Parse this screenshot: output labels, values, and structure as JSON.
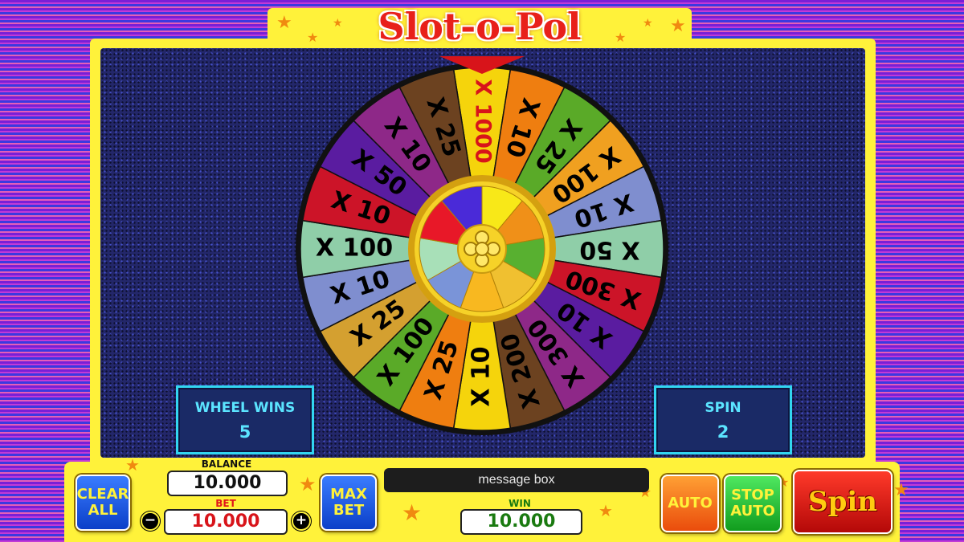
{
  "game": {
    "title": "Slot-o-Pol"
  },
  "wheel": {
    "segments": [
      {
        "label": "X 1000",
        "color": "#f5d40c",
        "text_color": "#d8141a"
      },
      {
        "label": "X 10",
        "color": "#ef7e10"
      },
      {
        "label": "X 25",
        "color": "#5aaa28"
      },
      {
        "label": "X 100",
        "color": "#f0a020"
      },
      {
        "label": "X 10",
        "color": "#7f8ecf"
      },
      {
        "label": "X 50",
        "color": "#8fcea8"
      },
      {
        "label": "X 300",
        "color": "#cc1428"
      },
      {
        "label": "X 10",
        "color": "#5a1ca0"
      },
      {
        "label": "X 300",
        "color": "#8e2888"
      },
      {
        "label": "X 200",
        "color": "#6c4220"
      },
      {
        "label": "X 10",
        "color": "#f5d40c"
      },
      {
        "label": "X 25",
        "color": "#ef7e10"
      },
      {
        "label": "X 100",
        "color": "#5aaa28"
      },
      {
        "label": "X 25",
        "color": "#d4a030"
      },
      {
        "label": "X 10",
        "color": "#7f8ecf"
      },
      {
        "label": "X 100",
        "color": "#8fcea8"
      },
      {
        "label": "X 10",
        "color": "#cc1428"
      },
      {
        "label": "X 50",
        "color": "#5a1ca0"
      },
      {
        "label": "X 10",
        "color": "#8e2888"
      },
      {
        "label": "X 25",
        "color": "#6c4220"
      }
    ],
    "hub_colors": [
      "#f8e818",
      "#f09018",
      "#58b030",
      "#f0c030",
      "#f8b820",
      "#7a94d8",
      "#a8e0b8",
      "#e81828",
      "#4a2ad8"
    ]
  },
  "wheel_wins": {
    "label": "WHEEL WINS",
    "value": "5"
  },
  "spin_count": {
    "label": "SPIN",
    "value": "2"
  },
  "balance": {
    "label": "BALANCE",
    "value": "10.000"
  },
  "bet": {
    "label": "BET",
    "value": "10.000",
    "decrease": "−",
    "increase": "+"
  },
  "win": {
    "label": "WIN",
    "value": "10.000"
  },
  "message": "message box",
  "buttons": {
    "clear_all_1": "CLEAR",
    "clear_all_2": "ALL",
    "max_bet_1": "MAX",
    "max_bet_2": "BET",
    "auto": "AUTO",
    "stop_auto_1": "STOP",
    "stop_auto_2": "AUTO",
    "spin": "Spin"
  }
}
